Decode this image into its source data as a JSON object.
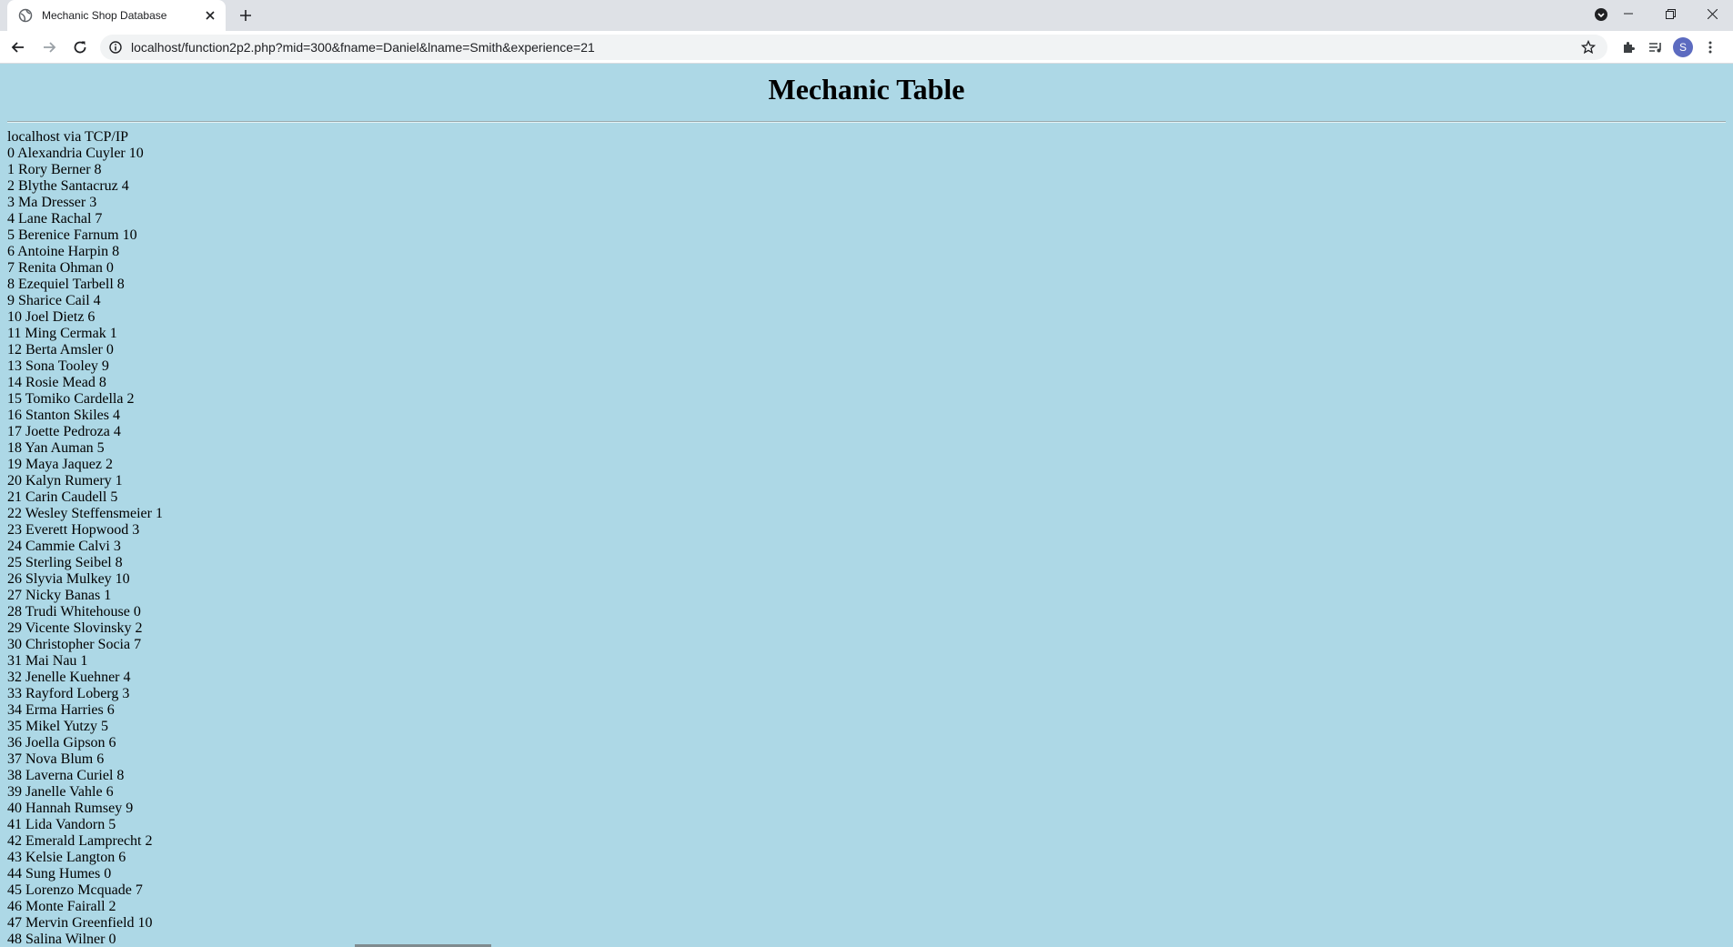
{
  "browser": {
    "tab_title": "Mechanic Shop Database",
    "url": "localhost/function2p2.php?mid=300&fname=Daniel&lname=Smith&experience=21",
    "profile_initial": "S",
    "icons": [
      "globe-icon",
      "close-icon",
      "plus-icon",
      "tab-search-icon",
      "minimize-icon",
      "restore-icon",
      "close-window-icon",
      "back-arrow-icon",
      "forward-arrow-icon",
      "reload-icon",
      "info-icon",
      "star-icon",
      "puzzle-icon",
      "media-icon",
      "more-icon"
    ]
  },
  "page": {
    "heading": "Mechanic Table",
    "connection_info": "localhost via TCP/IP",
    "mechanics": [
      "0 Alexandria Cuyler 10",
      "1 Rory Berner 8",
      "2 Blythe Santacruz 4",
      "3 Ma Dresser 3",
      "4 Lane Rachal 7",
      "5 Berenice Farnum 10",
      "6 Antoine Harpin 8",
      "7 Renita Ohman 0",
      "8 Ezequiel Tarbell 8",
      "9 Sharice Cail 4",
      "10 Joel Dietz 6",
      "11 Ming Cermak 1",
      "12 Berta Amsler 0",
      "13 Sona Tooley 9",
      "14 Rosie Mead 8",
      "15 Tomiko Cardella 2",
      "16 Stanton Skiles 4",
      "17 Joette Pedroza 4",
      "18 Yan Auman 5",
      "19 Maya Jaquez 2",
      "20 Kalyn Rumery 1",
      "21 Carin Caudell 5",
      "22 Wesley Steffensmeier 1",
      "23 Everett Hopwood 3",
      "24 Cammie Calvi 3",
      "25 Sterling Seibel 8",
      "26 Slyvia Mulkey 10",
      "27 Nicky Banas 1",
      "28 Trudi Whitehouse 0",
      "29 Vicente Slovinsky 2",
      "30 Christopher Socia 7",
      "31 Mai Nau 1",
      "32 Jenelle Kuehner 4",
      "33 Rayford Loberg 3",
      "34 Erma Harries 6",
      "35 Mikel Yutzy 5",
      "36 Joella Gipson 6",
      "37 Nova Blum 6",
      "38 Laverna Curiel 8",
      "39 Janelle Vahle 6",
      "40 Hannah Rumsey 9",
      "41 Lida Vandorn 5",
      "42 Emerald Lamprecht 2",
      "43 Kelsie Langton 6",
      "44 Sung Humes 0",
      "45 Lorenzo Mcquade 7",
      "46 Monte Fairall 2",
      "47 Mervin Greenfield 10",
      "48 Salina Wilner 0"
    ]
  }
}
